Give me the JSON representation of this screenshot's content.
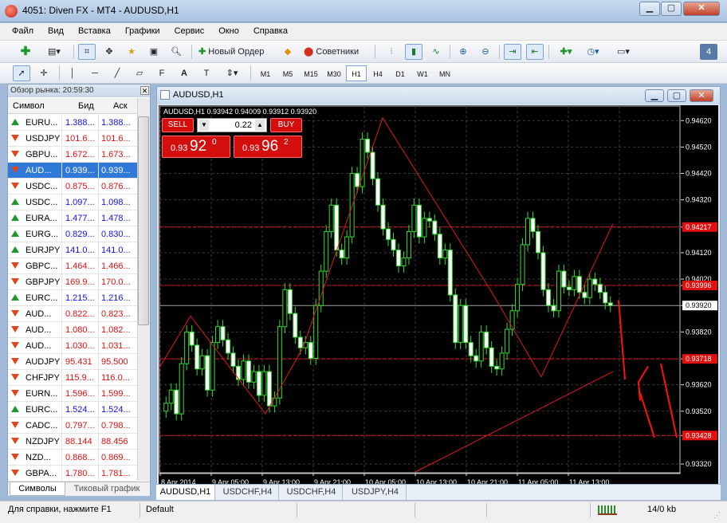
{
  "window": {
    "title": "4051: Diven FX - MT4 - AUDUSD,H1"
  },
  "menu": [
    "Файл",
    "Вид",
    "Вставка",
    "Графики",
    "Сервис",
    "Окно",
    "Справка"
  ],
  "toolbar": {
    "new_order": "Новый Ордер",
    "advisors": "Советники",
    "badge": "4"
  },
  "timeframes": [
    "M1",
    "M5",
    "M15",
    "M30",
    "H1",
    "H4",
    "D1",
    "W1",
    "MN"
  ],
  "timeframe_selected": "H1",
  "market_watch": {
    "header": "Обзор рынка: 20:59:30",
    "col_symbol": "Символ",
    "col_bid": "Бид",
    "col_ask": "Аск",
    "rows": [
      {
        "symbol": "EURU...",
        "bid": "1.388...",
        "ask": "1.388...",
        "dir": "up",
        "color": "blue"
      },
      {
        "symbol": "USDJPY",
        "bid": "101.6...",
        "ask": "101.6...",
        "dir": "dn",
        "color": "red"
      },
      {
        "symbol": "GBPU...",
        "bid": "1.672...",
        "ask": "1.673...",
        "dir": "dn",
        "color": "red"
      },
      {
        "symbol": "AUD...",
        "bid": "0.939...",
        "ask": "0.939...",
        "dir": "dn",
        "color": "red",
        "selected": true
      },
      {
        "symbol": "USDC...",
        "bid": "0.875...",
        "ask": "0.876...",
        "dir": "dn",
        "color": "red"
      },
      {
        "symbol": "USDC...",
        "bid": "1.097...",
        "ask": "1.098...",
        "dir": "up",
        "color": "blue"
      },
      {
        "symbol": "EURA...",
        "bid": "1.477...",
        "ask": "1.478...",
        "dir": "up",
        "color": "blue"
      },
      {
        "symbol": "EURG...",
        "bid": "0.829...",
        "ask": "0.830...",
        "dir": "up",
        "color": "blue"
      },
      {
        "symbol": "EURJPY",
        "bid": "141.0...",
        "ask": "141.0...",
        "dir": "up",
        "color": "blue"
      },
      {
        "symbol": "GBPC...",
        "bid": "1.464...",
        "ask": "1.466...",
        "dir": "dn",
        "color": "red"
      },
      {
        "symbol": "GBPJPY",
        "bid": "169.9...",
        "ask": "170.0...",
        "dir": "dn",
        "color": "red"
      },
      {
        "symbol": "EURC...",
        "bid": "1.215...",
        "ask": "1.216...",
        "dir": "up",
        "color": "blue"
      },
      {
        "symbol": "AUD...",
        "bid": "0.822...",
        "ask": "0.823...",
        "dir": "dn",
        "color": "red"
      },
      {
        "symbol": "AUD...",
        "bid": "1.080...",
        "ask": "1.082...",
        "dir": "dn",
        "color": "red"
      },
      {
        "symbol": "AUD...",
        "bid": "1.030...",
        "ask": "1.031...",
        "dir": "dn",
        "color": "red"
      },
      {
        "symbol": "AUDJPY",
        "bid": "95.431",
        "ask": "95.500",
        "dir": "dn",
        "color": "red"
      },
      {
        "symbol": "CHFJPY",
        "bid": "115.9...",
        "ask": "116.0...",
        "dir": "dn",
        "color": "red"
      },
      {
        "symbol": "EURN...",
        "bid": "1.596...",
        "ask": "1.599...",
        "dir": "dn",
        "color": "red"
      },
      {
        "symbol": "EURC...",
        "bid": "1.524...",
        "ask": "1.524...",
        "dir": "up",
        "color": "blue"
      },
      {
        "symbol": "CADC...",
        "bid": "0.797...",
        "ask": "0.798...",
        "dir": "dn",
        "color": "red"
      },
      {
        "symbol": "NZDJPY",
        "bid": "88.144",
        "ask": "88.456",
        "dir": "dn",
        "color": "red"
      },
      {
        "symbol": "NZD...",
        "bid": "0.868...",
        "ask": "0.869...",
        "dir": "dn",
        "color": "red"
      },
      {
        "symbol": "GBPA...",
        "bid": "1.780...",
        "ask": "1.781...",
        "dir": "dn",
        "color": "red"
      }
    ],
    "tabs": [
      "Символы",
      "Тиковый график"
    ]
  },
  "chart_window": {
    "title": "AUDUSD,H1"
  },
  "chart_info": "AUDUSD,H1  0.93942 0.94009 0.93912 0.93920",
  "one_click": {
    "sell": "SELL",
    "buy": "BUY",
    "lot": "0.22",
    "sell_small": "0.93",
    "sell_big": "92",
    "sell_sup": "0",
    "buy_small": "0.93",
    "buy_big": "96",
    "buy_sup": "2"
  },
  "chart_data": {
    "type": "line",
    "title": "",
    "price_ticks": [
      "0.94620",
      "0.94520",
      "0.94420",
      "0.94320",
      "0.94217",
      "0.94120",
      "0.94020",
      "0.93996",
      "0.93920",
      "0.93820",
      "0.93718",
      "0.93620",
      "0.93520",
      "0.93428",
      "0.93320"
    ],
    "price_tick_values": [
      0.9462,
      0.9452,
      0.9442,
      0.9432,
      0.94217,
      0.9412,
      0.9402,
      0.93996,
      0.9392,
      0.9382,
      0.93718,
      0.9362,
      0.9352,
      0.93428,
      0.9332
    ],
    "time_ticks": [
      "8 Apr 2014",
      "9 Apr 05:00",
      "9 Apr 13:00",
      "9 Apr 21:00",
      "10 Apr 05:00",
      "10 Apr 13:00",
      "10 Apr 21:00",
      "11 Apr 05:00",
      "11 Apr 13:00"
    ],
    "ylim": [
      0.9329,
      0.9466
    ],
    "hlines": [
      {
        "price": 0.94217,
        "label": "0.94217"
      },
      {
        "price": 0.93996,
        "label": "0.93996"
      },
      {
        "price": 0.93718,
        "label": "0.93718"
      },
      {
        "price": 0.93428,
        "label": "0.93428"
      }
    ],
    "last_price": 0.9392,
    "zigzag": [
      0.9368,
      0.9388,
      0.9351,
      0.9376,
      0.9463,
      0.9397,
      0.9365,
      0.9423
    ],
    "closes": [
      0.9355,
      0.936,
      0.9351,
      0.937,
      0.9382,
      0.9377,
      0.9368,
      0.9373,
      0.936,
      0.9378,
      0.9384,
      0.9379,
      0.9374,
      0.9369,
      0.9364,
      0.9371,
      0.9363,
      0.9367,
      0.9358,
      0.9367,
      0.9354,
      0.9357,
      0.9384,
      0.9398,
      0.9389,
      0.938,
      0.9376,
      0.9378,
      0.9372,
      0.9392,
      0.9405,
      0.942,
      0.943,
      0.9413,
      0.941,
      0.9418,
      0.9442,
      0.9437,
      0.9455,
      0.945,
      0.944,
      0.943,
      0.9421,
      0.9417,
      0.9413,
      0.9407,
      0.941,
      0.942,
      0.943,
      0.9418,
      0.9425,
      0.9424,
      0.9419,
      0.941,
      0.9413,
      0.9396,
      0.9378,
      0.9392,
      0.9378,
      0.9373,
      0.9371,
      0.9382,
      0.9376,
      0.9369,
      0.9368,
      0.9374,
      0.9383,
      0.939,
      0.94,
      0.9415,
      0.9425,
      0.942,
      0.9412,
      0.9398,
      0.9392,
      0.939,
      0.9405,
      0.9399,
      0.9398,
      0.9403,
      0.9397,
      0.9395,
      0.9402,
      0.94,
      0.9397,
      0.9393,
      0.9392
    ]
  },
  "chart_tabs": [
    "AUDUSD,H1",
    "USDCHF,H4",
    "USDCHF,H4",
    "USDJPY,H4"
  ],
  "status": {
    "help": "Для справки, нажмите F1",
    "profile": "Default",
    "traffic": "14/0 kb"
  }
}
